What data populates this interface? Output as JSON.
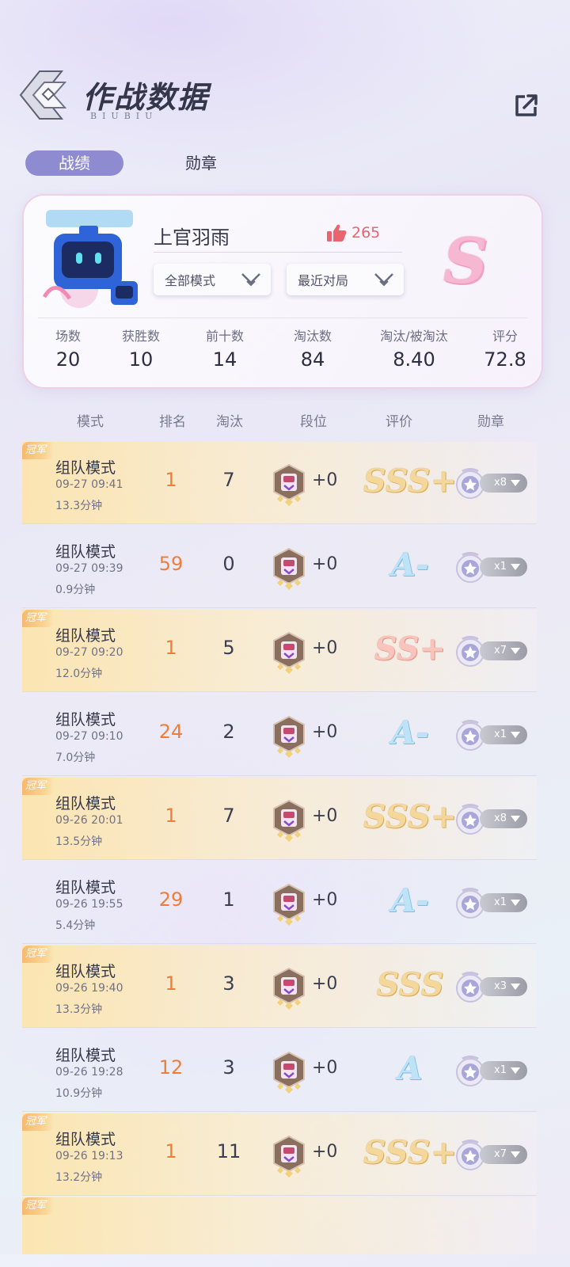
{
  "header": {
    "title": "作战数据",
    "subtitle": "BIUBIU"
  },
  "tabs": [
    {
      "label": "战绩"
    },
    {
      "label": "勋章"
    }
  ],
  "profile": {
    "name": "上官羽雨",
    "likes": "265",
    "mode_filter": "全部模式",
    "match_filter": "最近对局",
    "overall_grade": "S",
    "stats": [
      {
        "label": "场数",
        "value": "20"
      },
      {
        "label": "获胜数",
        "value": "10"
      },
      {
        "label": "前十数",
        "value": "14"
      },
      {
        "label": "淘汰数",
        "value": "84"
      },
      {
        "label": "淘汰/被淘汰",
        "value": "8.40"
      },
      {
        "label": "评分",
        "value": "72.8"
      }
    ]
  },
  "columns": [
    "模式",
    "排名",
    "淘汰",
    "段位",
    "评价",
    "勋章"
  ],
  "winner_badge": "冠军",
  "records": [
    {
      "mode": "组队模式",
      "time": "09-27 09:41",
      "duration": "13.3分钟",
      "rank": "1",
      "eliminations": "7",
      "rank_change": "+0",
      "grade": "SSS+",
      "grade_tier": "gold",
      "medal_count": "x8",
      "winner": true
    },
    {
      "mode": "组队模式",
      "time": "09-27 09:39",
      "duration": "0.9分钟",
      "rank": "59",
      "eliminations": "0",
      "rank_change": "+0",
      "grade": "A-",
      "grade_tier": "blue",
      "medal_count": "x1",
      "winner": false
    },
    {
      "mode": "组队模式",
      "time": "09-27 09:20",
      "duration": "12.0分钟",
      "rank": "1",
      "eliminations": "5",
      "rank_change": "+0",
      "grade": "SS+",
      "grade_tier": "pink",
      "medal_count": "x7",
      "winner": true
    },
    {
      "mode": "组队模式",
      "time": "09-27 09:10",
      "duration": "7.0分钟",
      "rank": "24",
      "eliminations": "2",
      "rank_change": "+0",
      "grade": "A-",
      "grade_tier": "blue",
      "medal_count": "x1",
      "winner": false
    },
    {
      "mode": "组队模式",
      "time": "09-26 20:01",
      "duration": "13.5分钟",
      "rank": "1",
      "eliminations": "7",
      "rank_change": "+0",
      "grade": "SSS+",
      "grade_tier": "gold",
      "medal_count": "x8",
      "winner": true
    },
    {
      "mode": "组队模式",
      "time": "09-26 19:55",
      "duration": "5.4分钟",
      "rank": "29",
      "eliminations": "1",
      "rank_change": "+0",
      "grade": "A-",
      "grade_tier": "blue",
      "medal_count": "x1",
      "winner": false
    },
    {
      "mode": "组队模式",
      "time": "09-26 19:40",
      "duration": "13.3分钟",
      "rank": "1",
      "eliminations": "3",
      "rank_change": "+0",
      "grade": "SSS",
      "grade_tier": "gold",
      "medal_count": "x3",
      "winner": true
    },
    {
      "mode": "组队模式",
      "time": "09-26 19:28",
      "duration": "10.9分钟",
      "rank": "12",
      "eliminations": "3",
      "rank_change": "+0",
      "grade": "A",
      "grade_tier": "blue",
      "medal_count": "x1",
      "winner": false
    },
    {
      "mode": "组队模式",
      "time": "09-26 19:13",
      "duration": "13.2分钟",
      "rank": "1",
      "eliminations": "11",
      "rank_change": "+0",
      "grade": "SSS+",
      "grade_tier": "gold",
      "medal_count": "x7",
      "winner": true
    }
  ],
  "icons": {
    "logo": "diamond-logo-icon",
    "share": "share-icon",
    "like": "thumbs-up-icon",
    "dropdown": "chevron-down-icon",
    "rank_tier": "rank-tier-icon",
    "medal": "medal-icon"
  },
  "colors": {
    "accent": "#8f8bd0",
    "rank": "#ee7d3a",
    "like": "#e9646e"
  }
}
